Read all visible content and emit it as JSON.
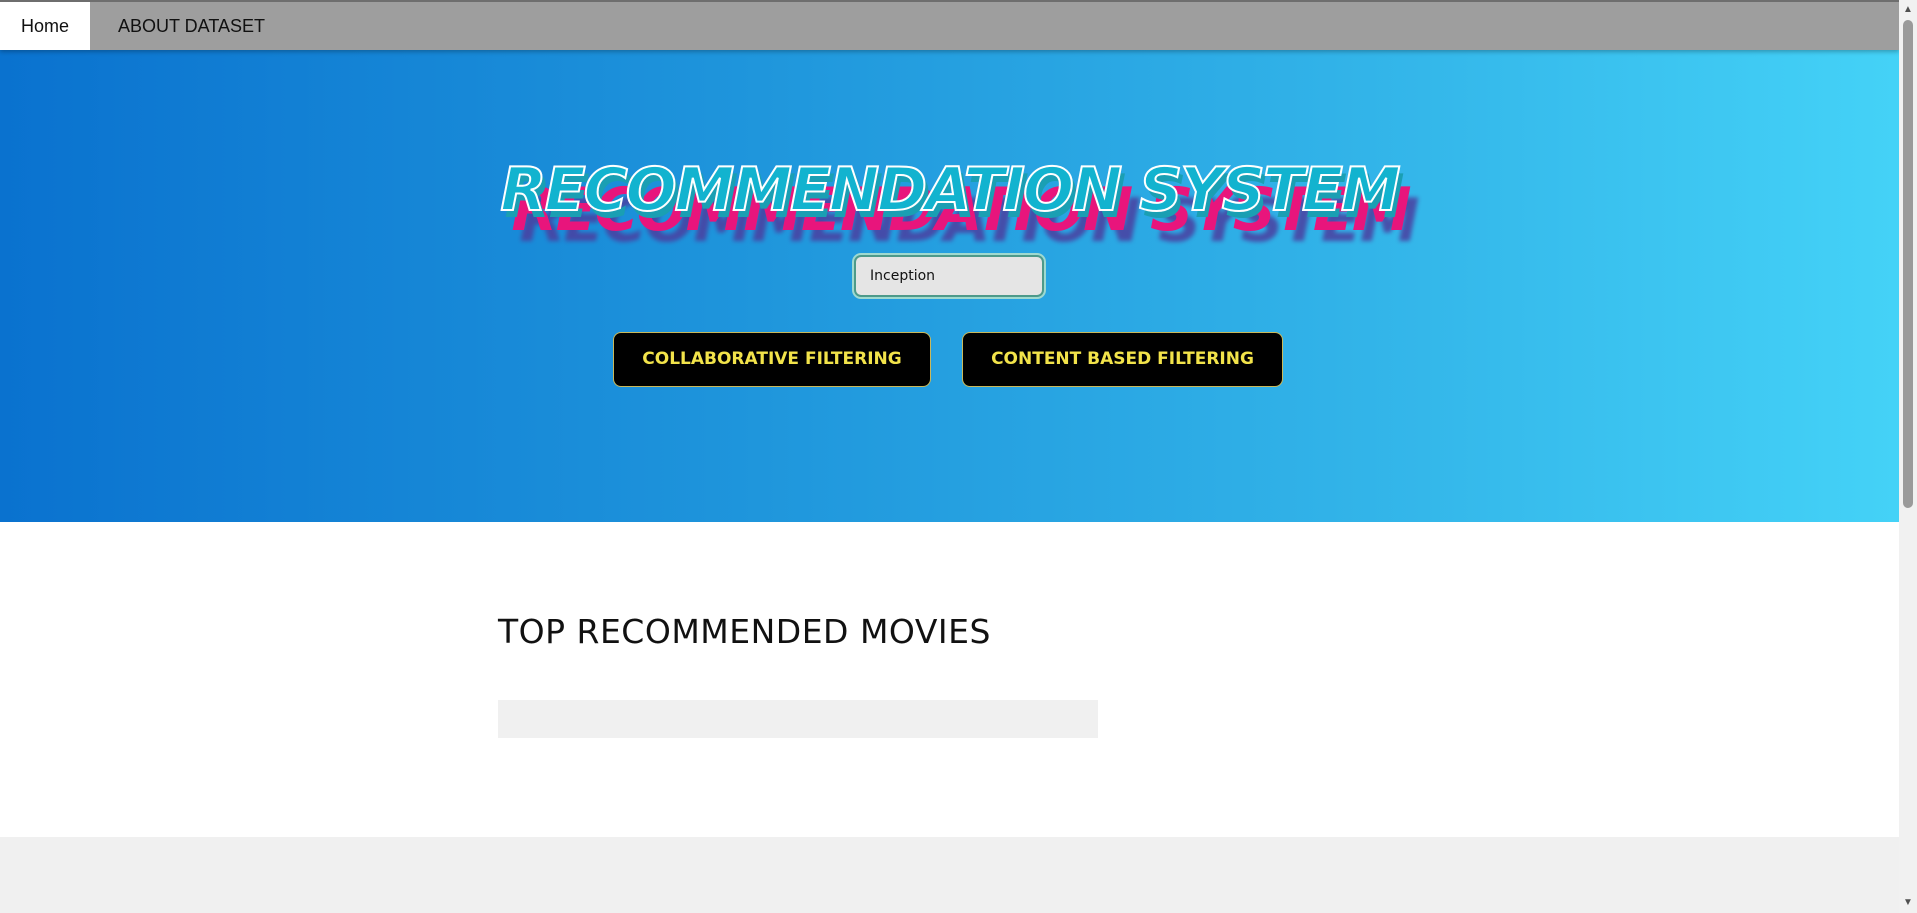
{
  "nav": {
    "items": [
      {
        "label": "Home",
        "active": true
      },
      {
        "label": "ABOUT DATASET",
        "active": false
      }
    ]
  },
  "hero": {
    "title": "RECOMMENDATION SYSTEM",
    "search": {
      "value": "Inception",
      "placeholder": ""
    },
    "buttons": {
      "collaborative": "COLLABORATIVE FILTERING",
      "content_based": "CONTENT BASED FILTERING"
    },
    "colors": {
      "gradient_start": "#0a72cf",
      "gradient_end": "#44d2f7",
      "button_text": "#f2e34a",
      "title_pink_shadow": "#e8157c",
      "title_teal": "#12b3cf"
    }
  },
  "main": {
    "section_title": "TOP RECOMMENDED MOVIES",
    "results": []
  },
  "scrollbar": {
    "up_icon": "▲",
    "down_icon": "▼"
  }
}
